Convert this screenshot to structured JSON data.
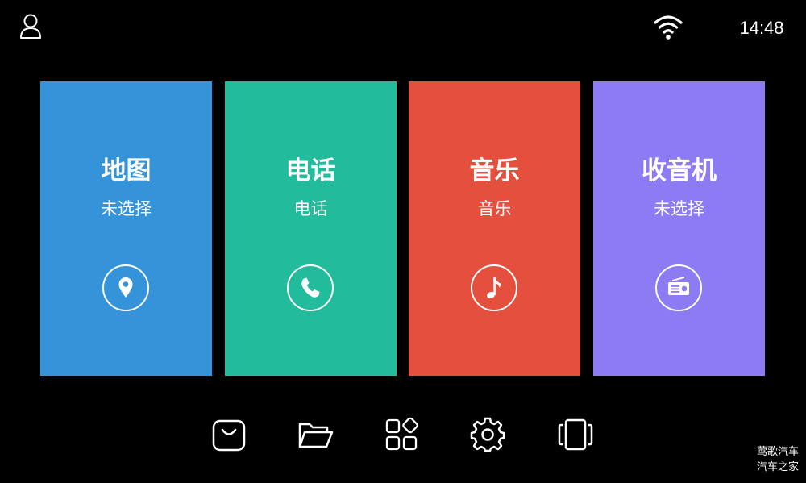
{
  "status_bar": {
    "time": "14:48",
    "user_icon": "user-icon",
    "wifi_icon": "wifi-icon"
  },
  "cards": [
    {
      "title": "地图",
      "subtitle": "未选择",
      "icon": "map-pin-icon",
      "color": "#3593d9"
    },
    {
      "title": "电话",
      "subtitle": "电话",
      "icon": "phone-icon",
      "color": "#22bb9c"
    },
    {
      "title": "音乐",
      "subtitle": "音乐",
      "icon": "music-note-icon",
      "color": "#e5503e"
    },
    {
      "title": "收音机",
      "subtitle": "未选择",
      "icon": "radio-icon",
      "color": "#8c7bf2"
    }
  ],
  "dock": [
    {
      "icon": "app-store-bag-icon"
    },
    {
      "icon": "folder-icon"
    },
    {
      "icon": "apps-grid-icon"
    },
    {
      "icon": "settings-gear-icon"
    },
    {
      "icon": "screen-switch-icon"
    }
  ],
  "watermark": {
    "line1": "莺歌汽车",
    "line2": "汽车之家"
  }
}
